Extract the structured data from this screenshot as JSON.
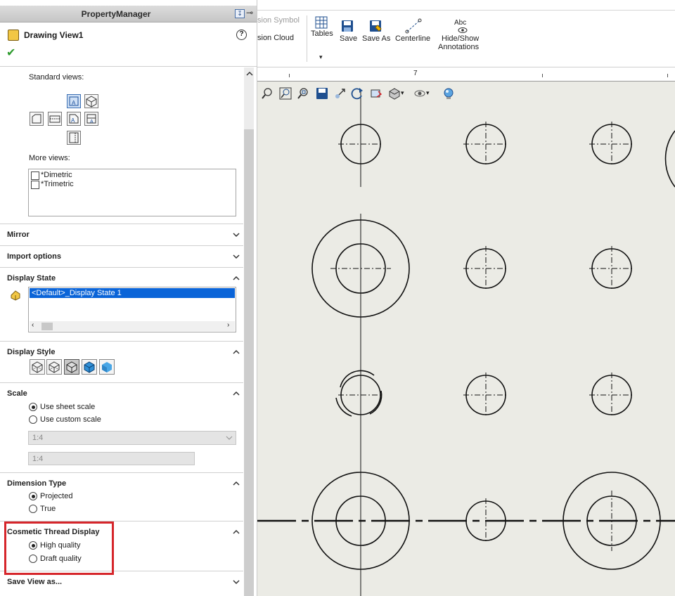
{
  "property_manager": {
    "title": "PropertyManager",
    "feature_title": "Drawing View1",
    "help": "?",
    "standard_views_label": "Standard views:",
    "more_views_label": "More views:",
    "more_views": [
      "*Dimetric",
      "*Trimetric"
    ],
    "sections": {
      "mirror": "Mirror",
      "import_options": "Import options",
      "display_state": "Display State",
      "display_style": "Display Style",
      "scale": "Scale",
      "dimension_type": "Dimension Type",
      "cosmetic_thread": "Cosmetic Thread Display",
      "save_view": "Save View as..."
    },
    "display_state_item": "<Default>_Display State 1",
    "scale": {
      "use_sheet_scale": "Use sheet scale",
      "use_custom_scale": "Use custom scale",
      "selected": "Use sheet scale",
      "dropdown_value": "1:4",
      "text_value": "1:4"
    },
    "dimension_type": {
      "projected": "Projected",
      "true": "True",
      "selected": "Projected"
    },
    "cosmetic_thread": {
      "high": "High quality",
      "draft": "Draft quality",
      "selected": "High quality"
    }
  },
  "toolbar": {
    "partial_1": "sion Symbol",
    "partial_2": "sion Cloud",
    "tables": "Tables",
    "save": "Save",
    "save_as": "Save As",
    "centerline": "Centerline",
    "abc": "Abc",
    "hide_show_1": "Hide/Show",
    "hide_show_2": "Annotations"
  },
  "ruler": {
    "label": "7"
  },
  "colors": {
    "accent_red": "#d6262b",
    "selection_blue": "#0a64d8",
    "ok_green": "#2e9b2e"
  }
}
